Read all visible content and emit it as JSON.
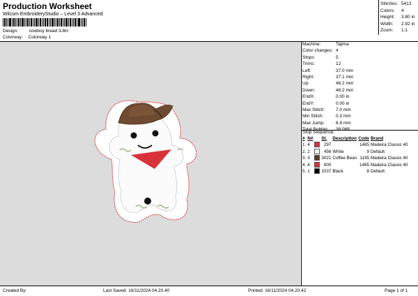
{
  "header": {
    "title": "Production Worksheet",
    "subtitle": "Wilcom EmbroideryStudio – Level 3 Advanced"
  },
  "design": {
    "design_label": "Design:",
    "design_value": "cowboy bread 3.8in",
    "colorway_label": "Colorway:",
    "colorway_value": "Colorway 1"
  },
  "stats": [
    {
      "k": "Stitches:",
      "v": "5413"
    },
    {
      "k": "Colors:",
      "v": "4"
    },
    {
      "k": "Height:",
      "v": "3.80 in"
    },
    {
      "k": "Width:",
      "v": "2.92 in"
    },
    {
      "k": "Zoom:",
      "v": "1:1"
    }
  ],
  "machine_info": [
    {
      "k": "Machine:",
      "v": "Tajima"
    },
    {
      "k": "Color changes:",
      "v": "4"
    },
    {
      "k": "Stops:",
      "v": "5"
    },
    {
      "k": "Trims:",
      "v": "12"
    },
    {
      "k": "Left:",
      "v": "37.0 mm"
    },
    {
      "k": "Right:",
      "v": "37.1 mm"
    },
    {
      "k": "Up:",
      "v": "48.2 mm"
    },
    {
      "k": "Down:",
      "v": "48.2 mm"
    },
    {
      "k": "EndX:",
      "v": "0.00 in"
    },
    {
      "k": "EndY:",
      "v": "0.00 in"
    },
    {
      "k": "Max Stitch:",
      "v": "7.0 mm"
    },
    {
      "k": "Min Stitch:",
      "v": "0.3 mm"
    },
    {
      "k": "Max Jump:",
      "v": "6.9 mm"
    },
    {
      "k": "Total Bobbin:",
      "v": "38.06ft"
    }
  ],
  "stop_sequence": {
    "heading": "Stop Sequence:",
    "columns": [
      "#",
      "N#",
      "",
      "St.",
      "Description",
      "Code",
      "Brand"
    ],
    "rows": [
      {
        "idx": "1.",
        "n": "4",
        "color": "#d9313a",
        "st": "297",
        "desc": "",
        "code": "1485",
        "brand": "Madeira Classic 40"
      },
      {
        "idx": "2.",
        "n": "2",
        "color": "#ffffff",
        "st": "456",
        "desc": "White",
        "code": "9",
        "brand": "Default"
      },
      {
        "idx": "3.",
        "n": "3",
        "color": "#5c3d26",
        "st": "3021",
        "desc": "Coffee Bean",
        "code": "1145",
        "brand": "Madeira Classic 40"
      },
      {
        "idx": "4.",
        "n": "4",
        "color": "#d9313a",
        "st": "600",
        "desc": "",
        "code": "1485",
        "brand": "Madeira Classic 40"
      },
      {
        "idx": "5.",
        "n": "1",
        "color": "#000000",
        "st": "1037",
        "desc": "Black",
        "code": "8",
        "brand": "Default"
      }
    ]
  },
  "footer": {
    "created_by": "Created By:",
    "last_saved": "Last Saved: 16/11/2024 04.20.40",
    "printed": "Printed: 16/11/2024 04.20.42",
    "page": "Page 1 of 1"
  }
}
